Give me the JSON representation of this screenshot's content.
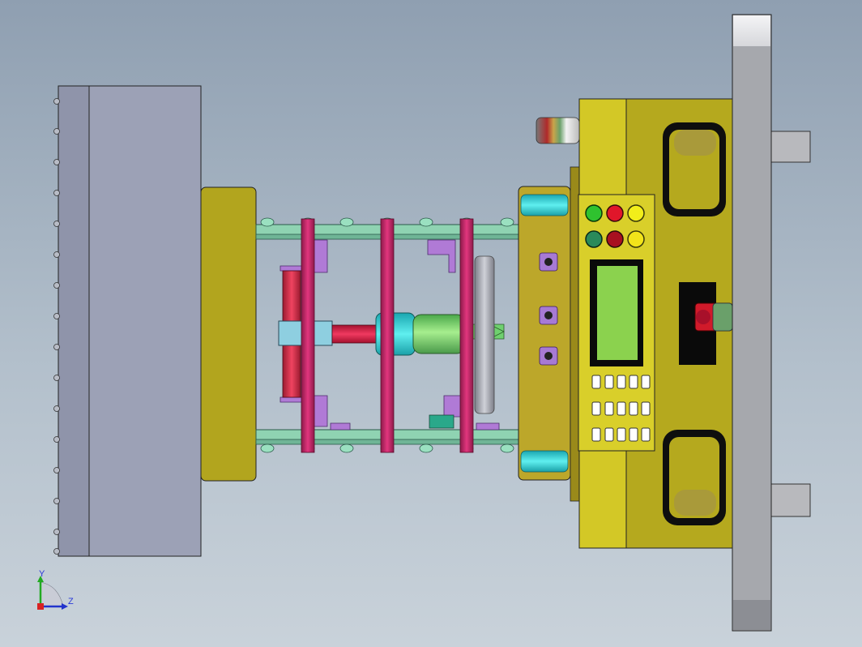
{
  "viewport": {
    "background_top": "#8f9fb1",
    "background_bottom": "#c9d2da"
  },
  "triad": {
    "y_label": "Y",
    "z_label": "Z",
    "y_color": "#22aa22",
    "z_color": "#2233cc"
  },
  "colors": {
    "mold_plate": "#9a9fb4",
    "platen_olive": "#b2a51e",
    "tie_rod_magenta": "#cc2a6e",
    "link_green": "#8fd3b2",
    "cylinder_cyan": "#36d6d6",
    "cylinder_green": "#7fd67f",
    "ram_red": "#d8244a",
    "control_yellow": "#d9cf2a",
    "screen_green": "#8bd24e",
    "frame_grey": "#a6a8ad"
  },
  "control_panel": {
    "indicator_lights": [
      "green-light",
      "red-light",
      "yellow-light",
      "dark-green-button",
      "dark-red-button",
      "yellow-button"
    ],
    "keypad_rows": 3,
    "keypad_cols": 5
  }
}
